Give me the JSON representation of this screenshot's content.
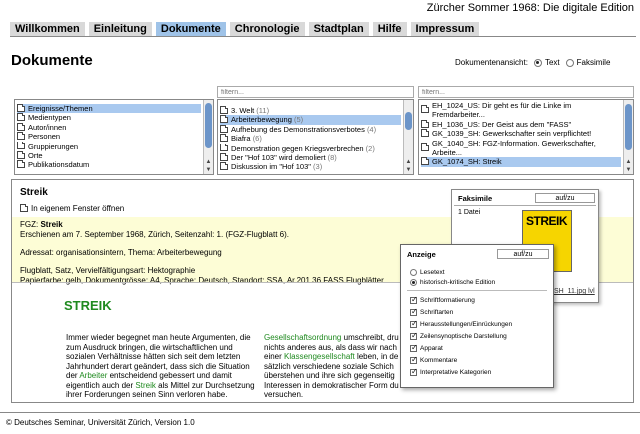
{
  "header": {
    "title": "Zürcher Sommer 1968: Die digitale Edition"
  },
  "nav": {
    "tabs": [
      {
        "label": "Willkommen",
        "active": false
      },
      {
        "label": "Einleitung",
        "active": false
      },
      {
        "label": "Dokumente",
        "active": true
      },
      {
        "label": "Chronologie",
        "active": false
      },
      {
        "label": "Stadtplan",
        "active": false
      },
      {
        "label": "Hilfe",
        "active": false
      },
      {
        "label": "Impressum",
        "active": false
      }
    ]
  },
  "page": {
    "title": "Dokumente"
  },
  "view_mode": {
    "label": "Dokumentenansicht:",
    "options": [
      "Text",
      "Faksimile"
    ],
    "selected": "Text"
  },
  "filters": {
    "placeholder": "filtern..."
  },
  "lists": {
    "categories": [
      {
        "label": "Ereignisse/Themen",
        "selected": true
      },
      {
        "label": "Medientypen"
      },
      {
        "label": "Autor/innen"
      },
      {
        "label": "Personen"
      },
      {
        "label": "Gruppierungen"
      },
      {
        "label": "Orte"
      },
      {
        "label": "Publikationsdatum"
      }
    ],
    "topics": [
      {
        "label": "3. Welt",
        "count": "(11)"
      },
      {
        "label": "Arbeiterbewegung",
        "count": "(5)",
        "selected": true
      },
      {
        "label": "Aufhebung des Demonstrationsverbotes",
        "count": "(4)"
      },
      {
        "label": "Biafra",
        "count": "(6)"
      },
      {
        "label": "Demonstration gegen Kriegsverbrechen",
        "count": "(2)"
      },
      {
        "label": "Der \"Hof 103\" wird demoliert",
        "count": "(8)"
      },
      {
        "label": "Diskussion im \"Hof 103\"",
        "count": "(3)"
      }
    ],
    "documents": [
      {
        "label": "EH_1024_US: Dir geht es für die Linke im Fremdarbeiter...",
        "wrap": true
      },
      {
        "label": "EH_1036_US: Der Geist aus dem \"FASS\""
      },
      {
        "label": "GK_1039_SH: Gewerkschafter sein verpflichtet!"
      },
      {
        "label": "GK_1040_SH: FGZ-Information. Gewerkschafter, Arbeite...",
        "wrap": true
      },
      {
        "label": "GK_1074_SH: Streik",
        "selected": true
      }
    ]
  },
  "document": {
    "title": "Streik",
    "new_window_label": "In eigenem Fenster öffnen",
    "meta": {
      "source_prefix": "FGZ: ",
      "source_title": "Streik",
      "published": "Erschienen am 7. September 1968, Zürich, Seitenzahl: 1. (FGZ-Flugblatt 6).",
      "recipient": "Adressat: organisationsintern, Thema: Arbeiterbewegung",
      "medium": "Flugblatt, Satz, Vervielfältigungsart: Hektographie",
      "paper": "Papierfarbe: gelb, Dokumentgrösse: A4, Sprache: Deutsch, Standort: SSA, Ar.201.36 FASS Flugblätter"
    },
    "heading": "STREIK",
    "col1": {
      "t1": "Immer wieder begegnet man heute Argumenten, die zum Ausdruck bringen, die wirtschaftlichen und sozialen Verhältnisse hätten sich seit dem letzten Jahrhundert derart geändert, dass sich die Situation der ",
      "l1": "Arbeiter",
      "t2": " entscheidend gebessert und damit eigentlich auch der ",
      "l2": "Streik",
      "t3": " als Mittel zur Durchsetzung ihrer Forderungen seinen Sinn verloren habe."
    },
    "col2": {
      "l1": "Gesellschaftsordnung",
      "t1": " umschreibt, dru nichts anderes aus, als dass wir nach einer ",
      "l2": "Klassengesellschaft",
      "t2": " leben, in de sätzlich verschiedene soziale Schich überstehen und ihre sich gegenseitig Interessen in demokratischer Form du versuchen."
    }
  },
  "faksimile": {
    "title": "Faksimile",
    "toggle_label": "auf/zu",
    "file_label": "1 Datei",
    "thumb_text": "STREIK",
    "link": "SH_11.jpg lvl"
  },
  "anzeige": {
    "title": "Anzeige",
    "toggle_label": "auf/zu",
    "radio_options": [
      {
        "label": "Lesetext",
        "selected": false
      },
      {
        "label": "historisch-kritische Edition",
        "selected": true
      }
    ],
    "checkboxes": [
      {
        "label": "Schriftformatierung",
        "checked": true
      },
      {
        "label": "Schriftarten",
        "checked": true
      },
      {
        "label": "Herausstellungen/Einrückungen",
        "checked": true
      },
      {
        "label": "Zeilensynoptische Darstellung",
        "checked": true
      },
      {
        "label": "Apparat",
        "checked": true
      },
      {
        "label": "Kommentare",
        "checked": true
      },
      {
        "label": "Interpretative Kategorien",
        "checked": true
      }
    ]
  },
  "footer": {
    "text": "© Deutsches Seminar, Universität Zürich, Version 1.0"
  },
  "colors": {
    "tab_active": "#9fc3e8",
    "tab": "#d9d9d9",
    "selection": "#a9c9ef",
    "meta_bg": "#fdfdd6",
    "link_green": "#1f8a1f",
    "scroll_thumb": "#6c95c9",
    "faksimile_yellow": "#f6d500"
  }
}
